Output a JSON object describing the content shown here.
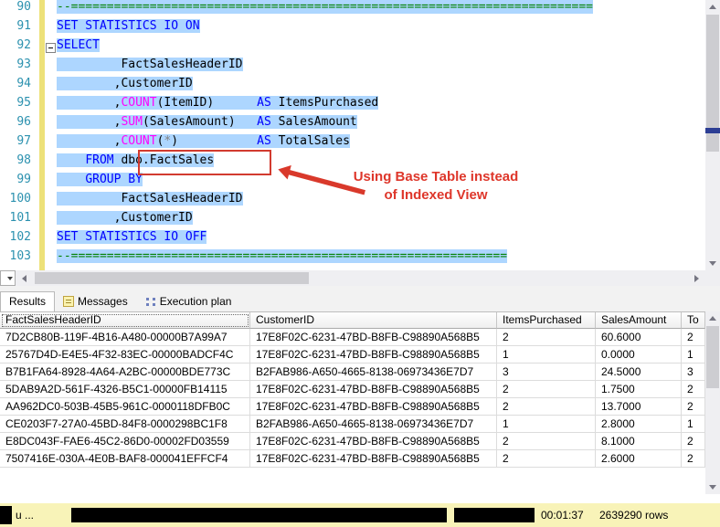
{
  "colors": {
    "selection": "#ADD6FF",
    "keyword": "#0000FF",
    "system_function": "#FF00FF",
    "comment": "#008000",
    "line_number": "#2B91AF",
    "annotation_red": "#D23B2F",
    "statusbar_bg": "#F8F3B8"
  },
  "editor": {
    "lines": [
      {
        "num": "90",
        "sel": true,
        "tokens": [
          {
            "t": "--=========================================================================",
            "c": "cm"
          }
        ]
      },
      {
        "num": "91",
        "sel": true,
        "tokens": [
          {
            "t": "SET STATISTICS IO ON",
            "c": "kw"
          }
        ]
      },
      {
        "num": "92",
        "sel": true,
        "tokens": [
          {
            "t": "SELECT",
            "c": "kw"
          }
        ]
      },
      {
        "num": "93",
        "sel": true,
        "tokens": [
          {
            "t": "         FactSalesHeaderID",
            "c": "id"
          }
        ]
      },
      {
        "num": "94",
        "sel": true,
        "tokens": [
          {
            "t": "        ,CustomerID",
            "c": "id"
          }
        ]
      },
      {
        "num": "95",
        "sel": true,
        "tokens": [
          {
            "t": "        ,",
            "c": "id"
          },
          {
            "t": "COUNT",
            "c": "fn"
          },
          {
            "t": "(ItemID)      ",
            "c": "id"
          },
          {
            "t": "AS",
            "c": "kw"
          },
          {
            "t": " ItemsPurchased",
            "c": "id"
          }
        ]
      },
      {
        "num": "96",
        "sel": true,
        "tokens": [
          {
            "t": "        ,",
            "c": "id"
          },
          {
            "t": "SUM",
            "c": "fn"
          },
          {
            "t": "(SalesAmount)   ",
            "c": "id"
          },
          {
            "t": "AS",
            "c": "kw"
          },
          {
            "t": " SalesAmount",
            "c": "id"
          }
        ]
      },
      {
        "num": "97",
        "sel": true,
        "tokens": [
          {
            "t": "        ,",
            "c": "id"
          },
          {
            "t": "COUNT",
            "c": "fn"
          },
          {
            "t": "(",
            "c": "id"
          },
          {
            "t": "*",
            "c": "op"
          },
          {
            "t": ")           ",
            "c": "id"
          },
          {
            "t": "AS",
            "c": "kw"
          },
          {
            "t": " TotalSales",
            "c": "id"
          }
        ]
      },
      {
        "num": "98",
        "sel": true,
        "tokens": [
          {
            "t": "    ",
            "c": "id"
          },
          {
            "t": "FROM",
            "c": "kw"
          },
          {
            "t": " dbo.FactSales",
            "c": "id"
          }
        ]
      },
      {
        "num": "99",
        "sel": true,
        "tokens": [
          {
            "t": "    ",
            "c": "id"
          },
          {
            "t": "GROUP BY",
            "c": "kw"
          }
        ]
      },
      {
        "num": "100",
        "sel": true,
        "tokens": [
          {
            "t": "         FactSalesHeaderID",
            "c": "id"
          }
        ]
      },
      {
        "num": "101",
        "sel": true,
        "tokens": [
          {
            "t": "        ,CustomerID",
            "c": "id"
          }
        ]
      },
      {
        "num": "102",
        "sel": true,
        "tokens": [
          {
            "t": "SET STATISTICS IO OFF",
            "c": "kw"
          }
        ]
      },
      {
        "num": "103",
        "sel": true,
        "tokens": [
          {
            "t": "--=============================================================",
            "c": "cm"
          }
        ]
      }
    ]
  },
  "annotation": {
    "line1": "Using Base Table instead",
    "line2": "of Indexed View"
  },
  "tabs": {
    "results": "Results",
    "messages": "Messages",
    "execution_plan": "Execution plan"
  },
  "grid": {
    "columns": [
      "FactSalesHeaderID",
      "CustomerID",
      "ItemsPurchased",
      "SalesAmount",
      "To"
    ],
    "rows": [
      [
        "7D2CB80B-119F-4B16-A480-00000B7A99A7",
        "17E8F02C-6231-47BD-B8FB-C98890A568B5",
        "2",
        "60.6000",
        "2"
      ],
      [
        "25767D4D-E4E5-4F32-83EC-00000BADCF4C",
        "17E8F02C-6231-47BD-B8FB-C98890A568B5",
        "1",
        "0.0000",
        "1"
      ],
      [
        "B7B1FA64-8928-4A64-A2BC-00000BDE773C",
        "B2FAB986-A650-4665-8138-06973436E7D7",
        "3",
        "24.5000",
        "3"
      ],
      [
        "5DAB9A2D-561F-4326-B5C1-00000FB14115",
        "17E8F02C-6231-47BD-B8FB-C98890A568B5",
        "2",
        "1.7500",
        "2"
      ],
      [
        "AA962DC0-503B-45B5-961C-0000118DFB0C",
        "17E8F02C-6231-47BD-B8FB-C98890A568B5",
        "2",
        "13.7000",
        "2"
      ],
      [
        "CE0203F7-27A0-45BD-84F8-0000298BC1F8",
        "B2FAB986-A650-4665-8138-06973436E7D7",
        "1",
        "2.8000",
        "1"
      ],
      [
        "E8DC043F-FAE6-45C2-86D0-00002FD03559",
        "17E8F02C-6231-47BD-B8FB-C98890A568B5",
        "2",
        "8.1000",
        "2"
      ],
      [
        "7507416E-030A-4E0B-BAF8-000041EFFCF4",
        "17E8F02C-6231-47BD-B8FB-C98890A568B5",
        "2",
        "2.6000",
        "2"
      ]
    ]
  },
  "statusbar": {
    "fragment": "u ...",
    "time": "00:01:37",
    "rows": "2639290 rows"
  }
}
